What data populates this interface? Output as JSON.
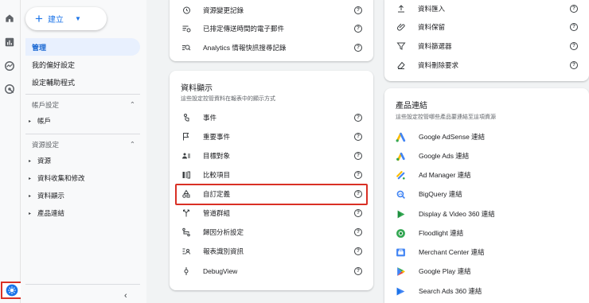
{
  "create": {
    "label": "建立"
  },
  "nav": {
    "top_items": [
      "管理",
      "我的偏好設定",
      "設定輔助程式"
    ],
    "account_section": {
      "title": "帳戶設定",
      "items": [
        "帳戶"
      ]
    },
    "property_section": {
      "title": "資源設定",
      "items": [
        "資源",
        "資料收集和修改",
        "資料顯示",
        "產品連結"
      ]
    }
  },
  "top_middle_card": {
    "rows": [
      "資源變更記錄",
      "已排定傳送時間的電子郵件",
      "Analytics 情報快訊搜尋記錄"
    ]
  },
  "top_right_card": {
    "rows": [
      "資料匯入",
      "資料保留",
      "資料篩選器",
      "資料刪除要求"
    ]
  },
  "data_display_card": {
    "title": "資料顯示",
    "subtitle": "這些設定控管資料在報表中的顯示方式",
    "rows": [
      "事件",
      "重要事件",
      "目標對象",
      "比較項目",
      "自訂定義",
      "管道群組",
      "歸因分析設定",
      "報表識別資訊",
      "DebugView"
    ]
  },
  "product_links_card": {
    "title": "產品連結",
    "subtitle": "這些設定控管哪些產品要連結至這項資源",
    "rows": [
      "Google AdSense 連結",
      "Google Ads 連結",
      "Ad Manager 連結",
      "BigQuery 連結",
      "Display & Video 360 連結",
      "Floodlight 連結",
      "Merchant Center 連結",
      "Google Play 連結",
      "Search Ads 360 連結"
    ]
  },
  "help_glyph": "?",
  "colors": {
    "accent": "#1a73e8",
    "highlight": "#d93025",
    "active_bg": "#e8f0fe"
  }
}
